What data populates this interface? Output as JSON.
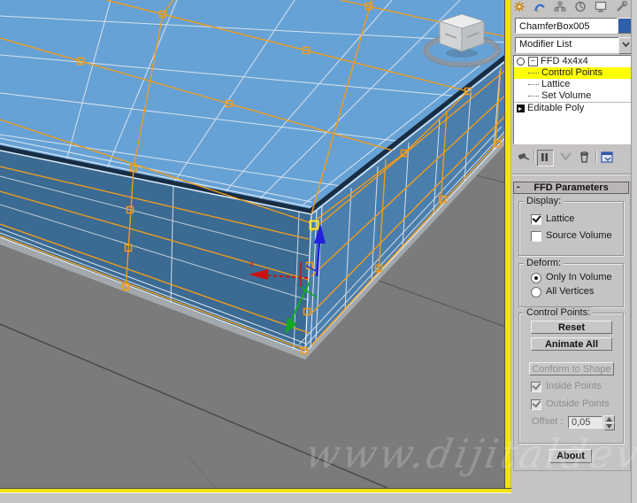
{
  "viewport": {
    "watermark": "www.dijitaldevs.com",
    "gizmo": {
      "x_label": "x"
    },
    "icons": [
      "view-cube",
      "move-gizmo"
    ],
    "colors": {
      "ground": "#7b7b7b",
      "top_face": "#67a2d6",
      "front_face": "#3b6a92",
      "right_face": "#4a7ead",
      "lattice_orange": "#ef9c1c",
      "selected_point_yellow": "#ffe92c",
      "active_border_yellow": "#f2e20d"
    }
  },
  "command_panel": {
    "tabs": [
      {
        "icon": "create-icon"
      },
      {
        "icon": "modify-icon"
      },
      {
        "icon": "hierarchy-icon"
      },
      {
        "icon": "motion-icon"
      },
      {
        "icon": "display-icon"
      },
      {
        "icon": "utilities-icon"
      }
    ],
    "object_name_field": {
      "value": "ChamferBox005"
    },
    "object_color": "#2e5ea8",
    "modifier_list": {
      "value": "Modifier List"
    },
    "modifier_stack": {
      "rows": [
        {
          "label": "FFD 4x4x4",
          "expanded": true
        },
        {
          "label": "Control Points",
          "highlighted": true
        },
        {
          "label": "Lattice",
          "highlighted": false
        },
        {
          "label": "Set Volume",
          "highlighted": false
        },
        {
          "label": "Editable Poly",
          "base": true
        }
      ]
    },
    "stack_toolbar": {
      "icons": [
        "pin-stack",
        "show-end-result",
        "make-unique",
        "remove-modifier",
        "configure-modifier-sets"
      ]
    },
    "rollout": {
      "title": "FFD Parameters",
      "collapse_glyph": "-",
      "display_group": {
        "legend": "Display:",
        "lattice": {
          "label": "Lattice",
          "checked": true
        },
        "source_volume": {
          "label": "Source Volume",
          "checked": false
        }
      },
      "deform_group": {
        "legend": "Deform:",
        "only_in_volume": {
          "label": "Only In Volume",
          "selected": true
        },
        "all_vertices": {
          "label": "All Vertices",
          "selected": false
        }
      },
      "control_points_group": {
        "legend": "Control Points:",
        "reset_label": "Reset",
        "animate_all_label": "Animate All",
        "conform_label": "Conform to Shape",
        "conform_disabled": true,
        "inside_points": {
          "label": "Inside Points",
          "checked": true,
          "disabled": true
        },
        "outside_points": {
          "label": "Outside Points",
          "checked": true,
          "disabled": true
        },
        "offset_label": "Offset :",
        "offset_value": "0,05"
      },
      "about_label": "About"
    }
  }
}
